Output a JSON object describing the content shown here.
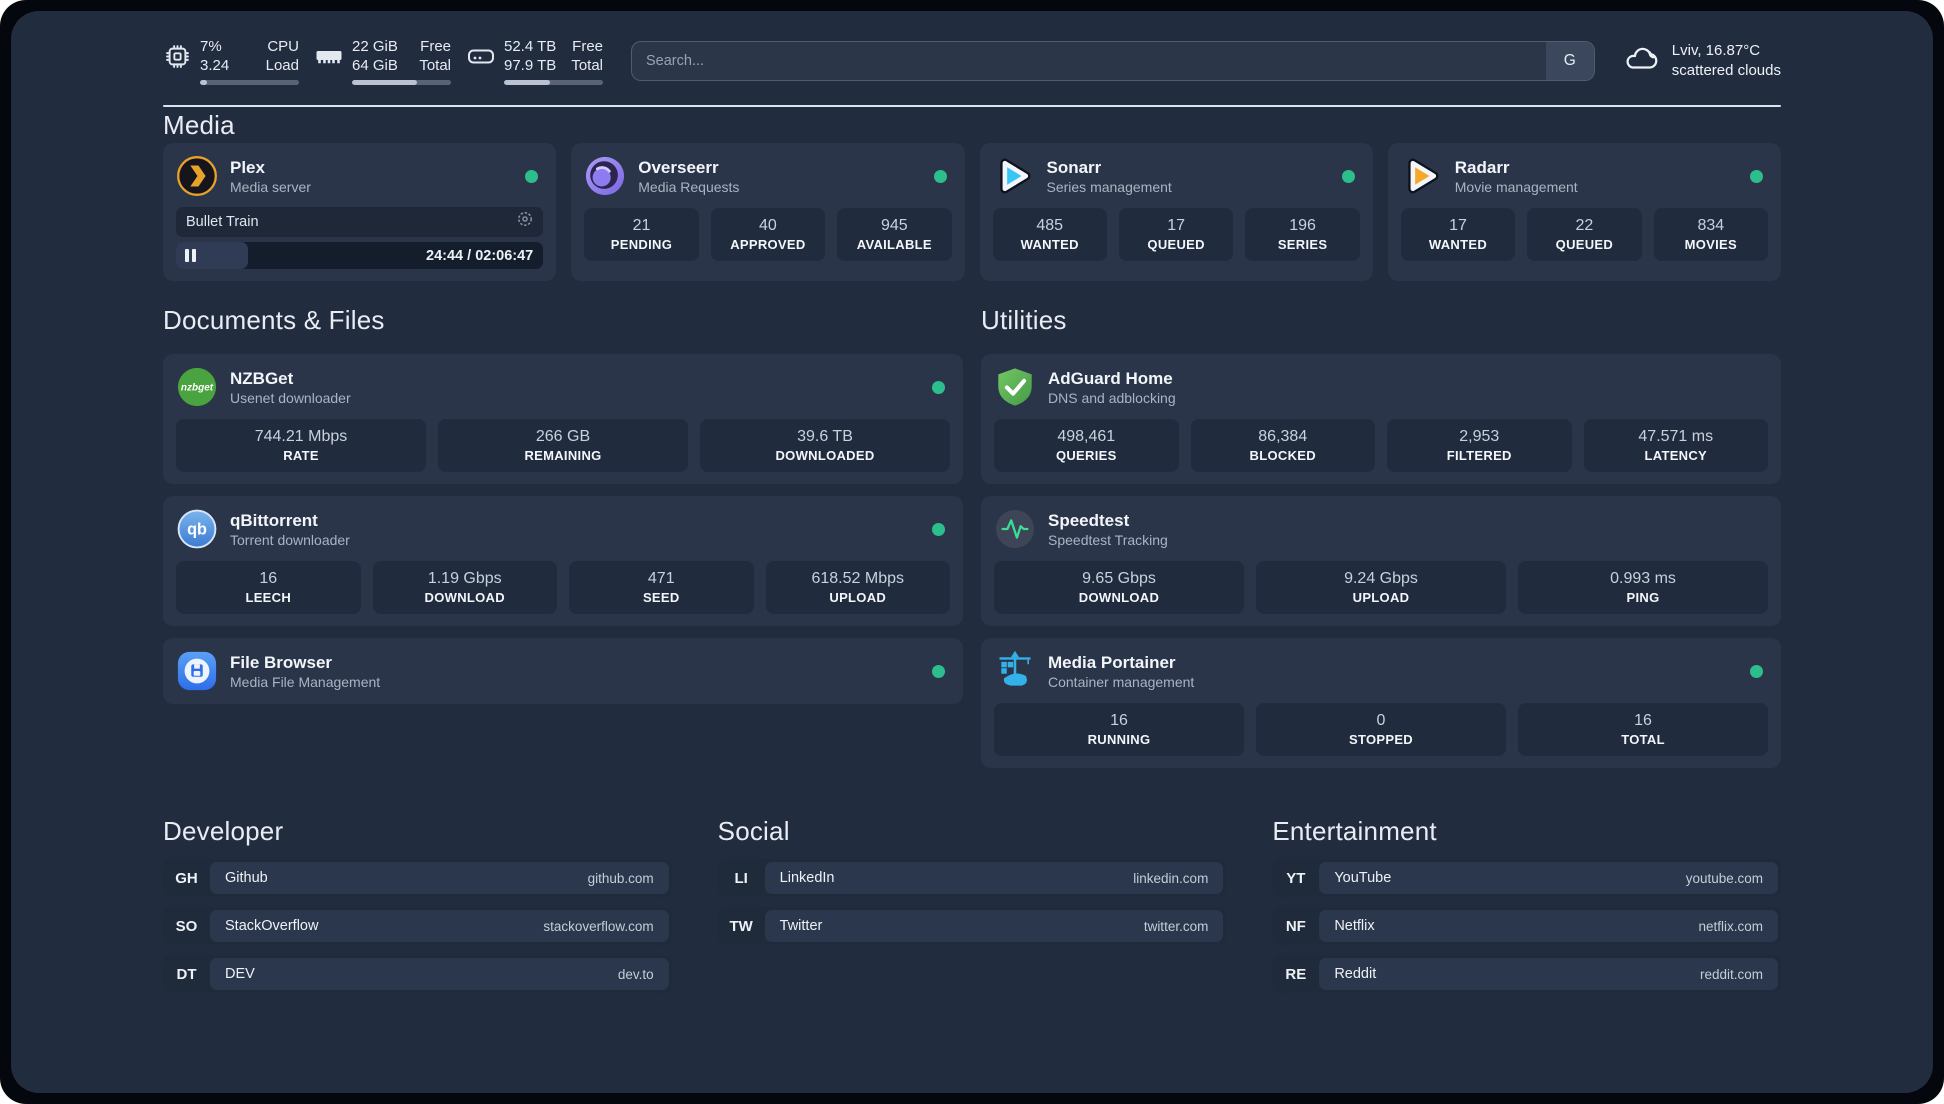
{
  "topbar": {
    "cpu": {
      "line1_value": "7%",
      "line2_value": "3.24",
      "line1_label": "CPU",
      "line2_label": "Load",
      "progress_percent": 7
    },
    "memory": {
      "line1_value": "22 GiB",
      "line2_value": "64 GiB",
      "line1_label": "Free",
      "line2_label": "Total",
      "progress_percent": 66
    },
    "disk": {
      "line1_value": "52.4 TB",
      "line2_value": "97.9 TB",
      "line1_label": "Free",
      "line2_label": "Total",
      "progress_percent": 46
    },
    "search": {
      "placeholder": "Search...",
      "engine_button": "G"
    },
    "weather": {
      "location_temp": "Lviv, 16.87°C",
      "condition": "scattered clouds"
    }
  },
  "sections": {
    "media_title": "Media",
    "documents_title": "Documents & Files",
    "utilities_title": "Utilities",
    "developer_title": "Developer",
    "social_title": "Social",
    "entertainment_title": "Entertainment"
  },
  "apps": {
    "plex": {
      "name": "Plex",
      "subtitle": "Media server",
      "player_title": "Bullet Train",
      "player_time": "24:44 / 02:06:47",
      "player_progress_percent": 19.5
    },
    "overseerr": {
      "name": "Overseerr",
      "subtitle": "Media Requests",
      "stats": [
        {
          "value": "21",
          "label": "PENDING"
        },
        {
          "value": "40",
          "label": "APPROVED"
        },
        {
          "value": "945",
          "label": "AVAILABLE"
        }
      ]
    },
    "sonarr": {
      "name": "Sonarr",
      "subtitle": "Series management",
      "stats": [
        {
          "value": "485",
          "label": "WANTED"
        },
        {
          "value": "17",
          "label": "QUEUED"
        },
        {
          "value": "196",
          "label": "SERIES"
        }
      ]
    },
    "radarr": {
      "name": "Radarr",
      "subtitle": "Movie management",
      "stats": [
        {
          "value": "17",
          "label": "WANTED"
        },
        {
          "value": "22",
          "label": "QUEUED"
        },
        {
          "value": "834",
          "label": "MOVIES"
        }
      ]
    },
    "nzbget": {
      "name": "NZBGet",
      "subtitle": "Usenet downloader",
      "stats": [
        {
          "value": "744.21 Mbps",
          "label": "RATE"
        },
        {
          "value": "266 GB",
          "label": "REMAINING"
        },
        {
          "value": "39.6 TB",
          "label": "DOWNLOADED"
        }
      ]
    },
    "qbittorrent": {
      "name": "qBittorrent",
      "subtitle": "Torrent downloader",
      "stats": [
        {
          "value": "16",
          "label": "LEECH"
        },
        {
          "value": "1.19 Gbps",
          "label": "DOWNLOAD"
        },
        {
          "value": "471",
          "label": "SEED"
        },
        {
          "value": "618.52 Mbps",
          "label": "UPLOAD"
        }
      ]
    },
    "filebrowser": {
      "name": "File Browser",
      "subtitle": "Media File Management"
    },
    "adguard": {
      "name": "AdGuard Home",
      "subtitle": "DNS and adblocking",
      "stats": [
        {
          "value": "498,461",
          "label": "QUERIES"
        },
        {
          "value": "86,384",
          "label": "BLOCKED"
        },
        {
          "value": "2,953",
          "label": "FILTERED"
        },
        {
          "value": "47.571 ms",
          "label": "LATENCY"
        }
      ]
    },
    "speedtest": {
      "name": "Speedtest",
      "subtitle": "Speedtest Tracking",
      "stats": [
        {
          "value": "9.65 Gbps",
          "label": "DOWNLOAD"
        },
        {
          "value": "9.24 Gbps",
          "label": "UPLOAD"
        },
        {
          "value": "0.993 ms",
          "label": "PING"
        }
      ]
    },
    "portainer": {
      "name": "Media Portainer",
      "subtitle": "Container management",
      "stats": [
        {
          "value": "16",
          "label": "RUNNING"
        },
        {
          "value": "0",
          "label": "STOPPED"
        },
        {
          "value": "16",
          "label": "TOTAL"
        }
      ]
    }
  },
  "bookmarks": {
    "developer": [
      {
        "abbr": "GH",
        "name": "Github",
        "url": "github.com"
      },
      {
        "abbr": "SO",
        "name": "StackOverflow",
        "url": "stackoverflow.com"
      },
      {
        "abbr": "DT",
        "name": "DEV",
        "url": "dev.to"
      }
    ],
    "social": [
      {
        "abbr": "LI",
        "name": "LinkedIn",
        "url": "linkedin.com"
      },
      {
        "abbr": "TW",
        "name": "Twitter",
        "url": "twitter.com"
      }
    ],
    "entertainment": [
      {
        "abbr": "YT",
        "name": "YouTube",
        "url": "youtube.com"
      },
      {
        "abbr": "NF",
        "name": "Netflix",
        "url": "netflix.com"
      },
      {
        "abbr": "RE",
        "name": "Reddit",
        "url": "reddit.com"
      }
    ]
  },
  "colors": {
    "status_online": "#2cbe8c",
    "accent_green": "#3ddc97"
  }
}
